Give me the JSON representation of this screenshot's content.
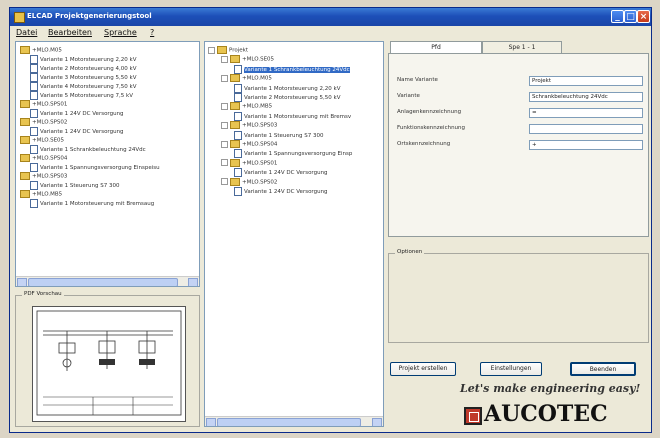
{
  "window": {
    "title": "ELCAD Projektgenerierungstool"
  },
  "menu": {
    "items": [
      "Datei",
      "Bearbeiten",
      "Sprache",
      "?"
    ]
  },
  "library_tree": [
    {
      "type": "folder",
      "label": "+MLO.M05"
    },
    {
      "type": "doc",
      "label": "Variante 1 Motorsteuerung 2,20 kV"
    },
    {
      "type": "doc",
      "label": "Variante 2 Motorsteuerung 4,00 kV"
    },
    {
      "type": "doc",
      "label": "Variante 3 Motorsteuerung 5,50 kV"
    },
    {
      "type": "doc",
      "label": "Variante 4 Motorsteuerung 7,50 kV"
    },
    {
      "type": "doc",
      "label": "Variante 5 Motorsteuerung 7,5 kV"
    },
    {
      "type": "folder",
      "label": "+MLO.SPS01"
    },
    {
      "type": "doc",
      "label": "Variante 1 24V DC Versorgung"
    },
    {
      "type": "folder",
      "label": "+MLO.SPS02"
    },
    {
      "type": "doc",
      "label": "Variante 1 24V DC Versorgung"
    },
    {
      "type": "folder",
      "label": "+MLO.SE05"
    },
    {
      "type": "doc",
      "label": "Variante 1 Schrankbeleuchtung 24Vdc"
    },
    {
      "type": "folder",
      "label": "+MLO.SPS04"
    },
    {
      "type": "doc",
      "label": "Variante 1 Spannungsversorgung Einspeisu"
    },
    {
      "type": "folder",
      "label": "+MLO.SPS03"
    },
    {
      "type": "doc",
      "label": "Variante 1 Steuerung S7 300"
    },
    {
      "type": "folder",
      "label": "+MLO.MB5"
    },
    {
      "type": "doc",
      "label": "Variante 1 Motorsteuerung mit Bremsaug"
    }
  ],
  "preview": {
    "label": "PDF Vorschau"
  },
  "project_tree": [
    {
      "type": "folder",
      "level": 0,
      "label": "Projekt"
    },
    {
      "type": "folder",
      "level": 1,
      "label": "+MLO.SE05"
    },
    {
      "type": "doc",
      "level": 2,
      "label": "Variante 1 Schrankbeleuchtung 24Vdc",
      "selected": true
    },
    {
      "type": "folder",
      "level": 1,
      "label": "+MLO.M05"
    },
    {
      "type": "doc",
      "level": 2,
      "label": "Variante 1 Motorsteuerung 2,20 kV"
    },
    {
      "type": "doc",
      "level": 2,
      "label": "Variante 2 Motorsteuerung 5,50 kV"
    },
    {
      "type": "folder",
      "level": 1,
      "label": "+MLO.MB5"
    },
    {
      "type": "doc",
      "level": 2,
      "label": "Variante 1 Motorsteuerung mit Bremsv"
    },
    {
      "type": "folder",
      "level": 1,
      "label": "+MLO.SPS03"
    },
    {
      "type": "doc",
      "level": 2,
      "label": "Variante 1 Steuerung S7 300"
    },
    {
      "type": "folder",
      "level": 1,
      "label": "+MLO.SPS04"
    },
    {
      "type": "doc",
      "level": 2,
      "label": "Variante 1 Spannungsversorgung Einsp"
    },
    {
      "type": "folder",
      "level": 1,
      "label": "+MLO.SPS01"
    },
    {
      "type": "doc",
      "level": 2,
      "label": "Variante 1 24V DC Versorgung"
    },
    {
      "type": "folder",
      "level": 1,
      "label": "+MLO.SPS02"
    },
    {
      "type": "doc",
      "level": 2,
      "label": "Variante 1 24V DC Versorgung"
    }
  ],
  "tabs": [
    "Pfd",
    "Spe 1 - 1"
  ],
  "properties": [
    {
      "label": "Name Variante",
      "value": "Projekt"
    },
    {
      "label": "Variante",
      "value": "Schrankbeleuchtung 24Vdc"
    },
    {
      "label": "Anlagenkennzeichnung",
      "value": "="
    },
    {
      "label": "Funktionskennzeichnung",
      "value": ""
    },
    {
      "label": "Ortskennzeichnung",
      "value": "+"
    }
  ],
  "options": {
    "label": "Optionen"
  },
  "buttons": {
    "create": "Projekt erstellen",
    "settings": "Einstellungen",
    "close": "Beenden"
  },
  "branding": {
    "tagline": "Let's make engineering easy!",
    "company": "AUCOTEC"
  },
  "colors": {
    "titlebar": "#1d4fb8",
    "selection": "#316ac5",
    "logo_red": "#c0392b"
  }
}
